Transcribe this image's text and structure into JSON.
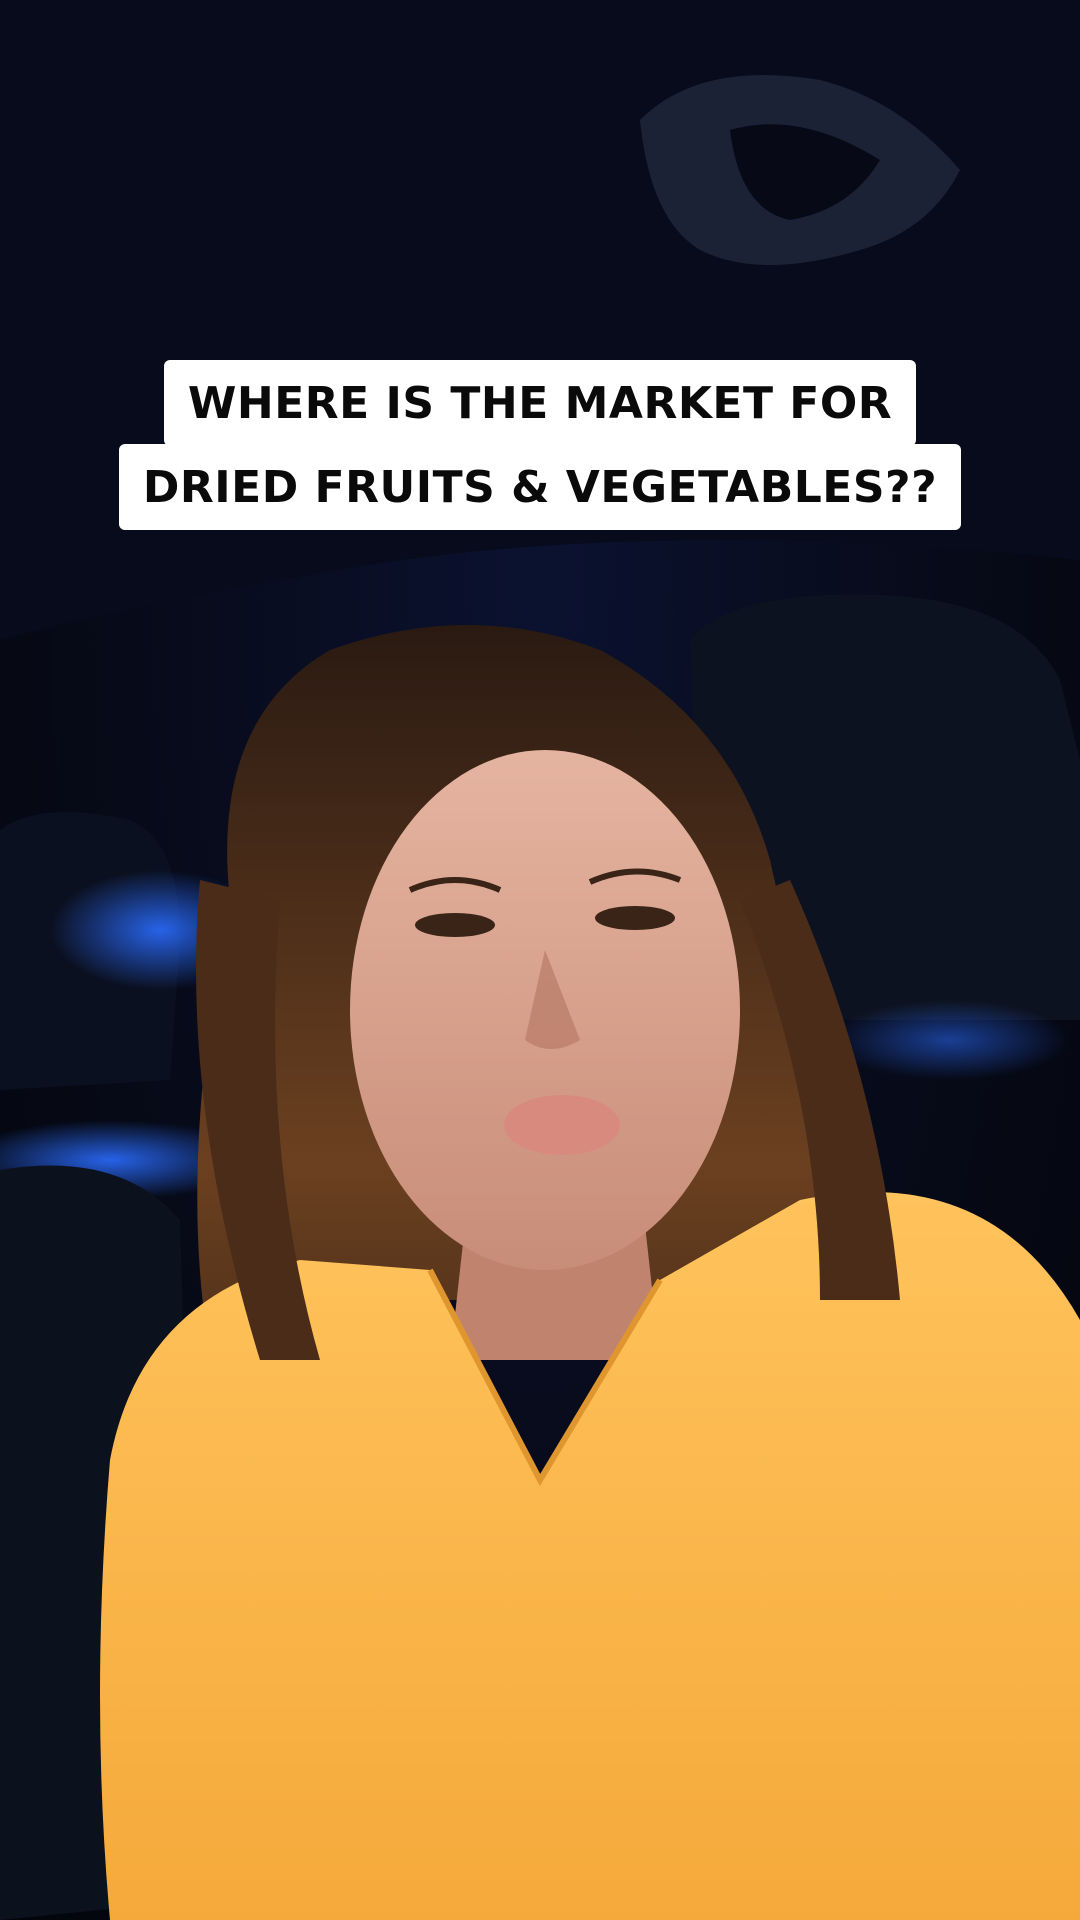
{
  "video": {
    "caption_lines": [
      "WHERE IS THE MARKET FOR",
      "DRIED FRUITS & VEGETABLES??"
    ]
  },
  "colors": {
    "caption_bg": "#ffffff",
    "caption_text": "#0a0a0a",
    "shirt": "#f9b84a",
    "car_interior": "#070a18",
    "ambient_blue": "#2a6cff"
  },
  "icons": [
    "overhead-handle-icon"
  ]
}
